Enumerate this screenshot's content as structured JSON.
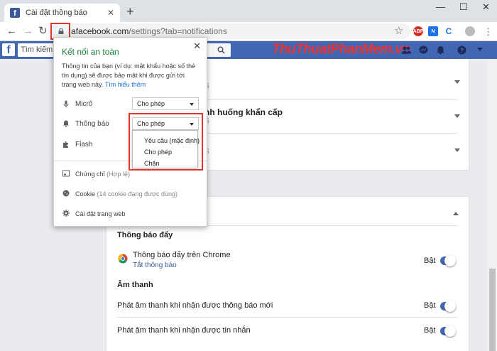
{
  "browser": {
    "tab_title": "Cài đặt thông báo",
    "url_host": "facebook.com",
    "url_path": "/settings?tab=notifications",
    "url_host_prefix": "a"
  },
  "facebook": {
    "search_placeholder": "Tìm kiếm",
    "watermark": "ThuThuatPhanMem.vn"
  },
  "page": {
    "row2_title_fragment": "nh huống khẩn cấp",
    "push_section_title": "Thông báo đẩy",
    "chrome_push_label": "Thông báo đẩy trên Chrome",
    "chrome_push_link": "Tắt thông báo",
    "chrome_push_status": "Bật",
    "sound_section_title": "Âm thanh",
    "sound_row1_label": "Phát âm thanh khi nhận được thông báo mới",
    "sound_row1_status": "Bật",
    "sound_row2_label": "Phát âm thanh khi nhận được tin nhắn",
    "sound_row2_status": "Bật"
  },
  "popup": {
    "title": "Kết nối an toàn",
    "description": "Thông tin của bạn (ví dụ: mật khẩu hoặc số thẻ tín dụng) sẽ được bảo mật khi được gửi tới trang web này.",
    "learn_more": "Tìm hiểu thêm",
    "mic_label": "Micrô",
    "mic_value": "Cho phép",
    "notif_label": "Thông báo",
    "notif_value": "Cho phép",
    "flash_label": "Flash",
    "cert_label": "Chứng chỉ",
    "cert_status": "(Hợp lệ)",
    "cookie_label": "Cookie",
    "cookie_status": "(14 cookie đang được dùng)",
    "site_settings": "Cài đặt trang web",
    "dropdown_options": [
      "Yêu cầu (mặc định)",
      "Cho phép",
      "Chặn"
    ]
  }
}
